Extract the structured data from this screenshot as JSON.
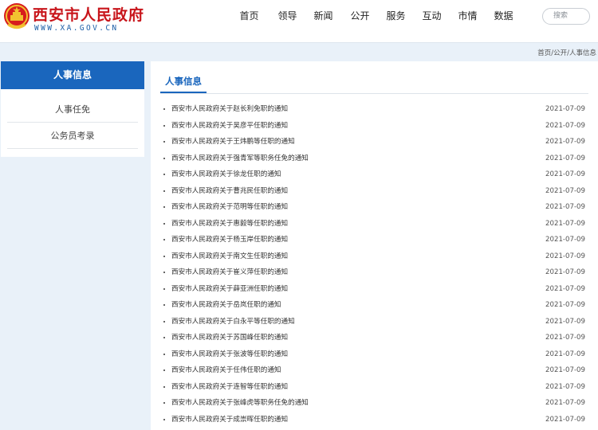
{
  "header": {
    "site_title": "西安市人民政府",
    "site_domain": "WWW.XA.GOV.CN",
    "nav": [
      "首页",
      "领导",
      "新闻",
      "公开",
      "服务",
      "互动",
      "市情",
      "数据"
    ],
    "search_label": "搜索"
  },
  "breadcrumb": [
    "首页",
    "公开",
    "人事信息"
  ],
  "breadcrumb_sep": " / ",
  "sidebar": {
    "title": "人事信息",
    "items": [
      "人事任免",
      "公务员考录"
    ]
  },
  "main": {
    "tab": "人事信息",
    "items": [
      {
        "title": "西安市人民政府关于赵长利免职的通知",
        "date": "2021-07-09"
      },
      {
        "title": "西安市人民政府关于吴彦平任职的通知",
        "date": "2021-07-09"
      },
      {
        "title": "西安市人民政府关于王炜鹏等任职的通知",
        "date": "2021-07-09"
      },
      {
        "title": "西安市人民政府关于强青军等职务任免的通知",
        "date": "2021-07-09"
      },
      {
        "title": "西安市人民政府关于徐龙任职的通知",
        "date": "2021-07-09"
      },
      {
        "title": "西安市人民政府关于曹兆民任职的通知",
        "date": "2021-07-09"
      },
      {
        "title": "西安市人民政府关于范明等任职的通知",
        "date": "2021-07-09"
      },
      {
        "title": "西安市人民政府关于惠毅等任职的通知",
        "date": "2021-07-09"
      },
      {
        "title": "西安市人民政府关于杨玉岸任职的通知",
        "date": "2021-07-09"
      },
      {
        "title": "西安市人民政府关于南文生任职的通知",
        "date": "2021-07-09"
      },
      {
        "title": "西安市人民政府关于崔义萍任职的通知",
        "date": "2021-07-09"
      },
      {
        "title": "西安市人民政府关于薛亚洲任职的通知",
        "date": "2021-07-09"
      },
      {
        "title": "西安市人民政府关于岳岚任职的通知",
        "date": "2021-07-09"
      },
      {
        "title": "西安市人民政府关于白永平等任职的通知",
        "date": "2021-07-09"
      },
      {
        "title": "西安市人民政府关于苏国峰任职的通知",
        "date": "2021-07-09"
      },
      {
        "title": "西安市人民政府关于张波等任职的通知",
        "date": "2021-07-09"
      },
      {
        "title": "西安市人民政府关于任伟任职的通知",
        "date": "2021-07-09"
      },
      {
        "title": "西安市人民政府关于连智等任职的通知",
        "date": "2021-07-09"
      },
      {
        "title": "西安市人民政府关于张峰虎等职务任免的通知",
        "date": "2021-07-09"
      },
      {
        "title": "西安市人民政府关于成崇晖任职的通知",
        "date": "2021-07-09"
      }
    ]
  },
  "colors": {
    "accent": "#1a66bd",
    "brand_red": "#c8151b",
    "background": "#e9f1f9"
  }
}
